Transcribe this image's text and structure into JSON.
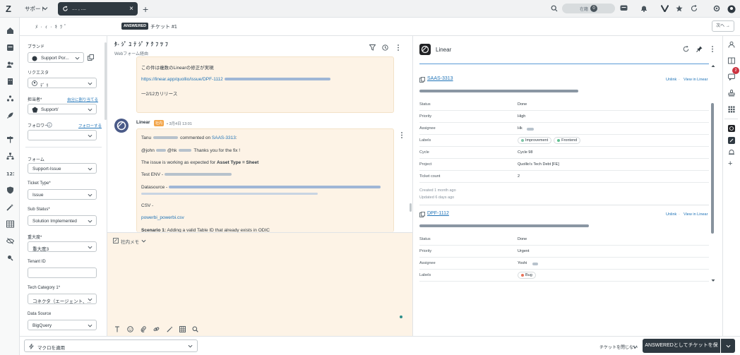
{
  "topbar": {
    "brand_switch": "サポート",
    "active_tab_title": "....  ,  ....",
    "status_label": "在籍",
    "status_count": "0"
  },
  "subheader": {
    "breadcrumbs": "ﾒ · ｨ · ｷ  ﾂ ﾟ",
    "status_badge": "ANSWERED",
    "ticket_label": "チケット #1",
    "next_label": "次へ →"
  },
  "properties": {
    "brand_label": "ブランド",
    "brand_value": "Support Por...",
    "requester_label": "リクエスタ",
    "requester_value": "ﾃﾞ ﾘ",
    "assignee_label": "担当者*",
    "assign_me": "自分に割り当てる",
    "assignee_value": "Support/",
    "follower_label": "フォロワー",
    "follow_link": "フォローする",
    "follower_value": "",
    "form_label": "フォーム",
    "form_value": "Support-Issue",
    "ticket_type_label": "Ticket Type*",
    "ticket_type_value": "Issue",
    "sub_status_label": "Sub Status*",
    "sub_status_value": "Solution Implemented",
    "severity_label": "重大度*",
    "severity_value": "重大度3",
    "tenant_label": "Tenant ID",
    "tenant_value": "",
    "tech_cat_label": "Tech Category 1*",
    "tech_cat_value": "コネクタ（エージェント、...",
    "data_source_label": "Data Source",
    "data_source_value": "BigQuery"
  },
  "conversation": {
    "title": "ﾀ- ｼﾞ ﾕ ﾃ ｼﾞ ｱ ｸ ﾌ ﾂ ﾌ",
    "subtitle": "Webフォーム経由",
    "prev_line1": "この件は複数のLinearの修正が実現",
    "prev_link": "https://linear.app/quollio/issue/DPF-1112",
    "prev_line3": "一2/12カリリース",
    "author": "Linear",
    "internal_badge": "社内",
    "date": "• 3月4日 13:01",
    "msg_commenter": "Tanu",
    "msg_commented_on": "commented on",
    "msg_issue": "SAAS-3313",
    "msg_line2_pre": "@john",
    "msg_line2_mid": "@hk",
    "msg_line2_post": "Thanks you for the fix !",
    "msg_line3_pre": "The issue is working as expected for ",
    "msg_line3_bold": "Asset Type = Sheet",
    "msg_line4": "Test ENV -",
    "msg_line5": "Datasource -",
    "msg_line6": "CSV -",
    "msg_link_csv": "powerbi_powerbi.csv",
    "msg_line8_bold": "Scenario 1:",
    "msg_line8": " Adding a valid Table ID that already exists in ODIC"
  },
  "composer": {
    "mode_label": "社内メモ"
  },
  "app": {
    "name": "Linear",
    "issues": [
      {
        "key": "SAAS-3313",
        "unlink": "Unlink",
        "view": "View in Linear",
        "fields": [
          {
            "k": "Status",
            "v": "Done"
          },
          {
            "k": "Priority",
            "v": "High"
          },
          {
            "k": "Assignee",
            "v": "Hk"
          },
          {
            "k": "Labels",
            "v": ""
          },
          {
            "k": "Cycle",
            "v": "Cycle 98"
          },
          {
            "k": "Project",
            "v": "Quollio's Tech Debt [FE]"
          },
          {
            "k": "Ticket count",
            "v": "2"
          }
        ],
        "labels": [
          {
            "name": "Improvement",
            "color": "#7fc5a7"
          },
          {
            "name": "Frontend",
            "color": "#5fbf8f"
          }
        ],
        "created": "Created 1 month ago",
        "updated": "Updated 6 days ago"
      },
      {
        "key": "DPF-1112",
        "unlink": "Unlink",
        "view": "View in Linear",
        "fields": [
          {
            "k": "Status",
            "v": "Done"
          },
          {
            "k": "Priority",
            "v": "Urgent"
          },
          {
            "k": "Assignee",
            "v": "Yoshi"
          },
          {
            "k": "Labels",
            "v": ""
          }
        ],
        "labels": [
          {
            "name": "Bug",
            "color": "#e8735a"
          }
        ]
      }
    ]
  },
  "rail": {
    "notification_count": "2"
  },
  "bottom": {
    "macro_placeholder": "マクロを適用",
    "close_option": "チケットを閉じない",
    "submit_label": "ANSWEREDとしてチケットを保存"
  },
  "colors": {
    "dark": "#2f3941",
    "internal_note_bg": "#fdf3e6",
    "link": "#1f73b7",
    "badge_red": "#cc3340"
  }
}
